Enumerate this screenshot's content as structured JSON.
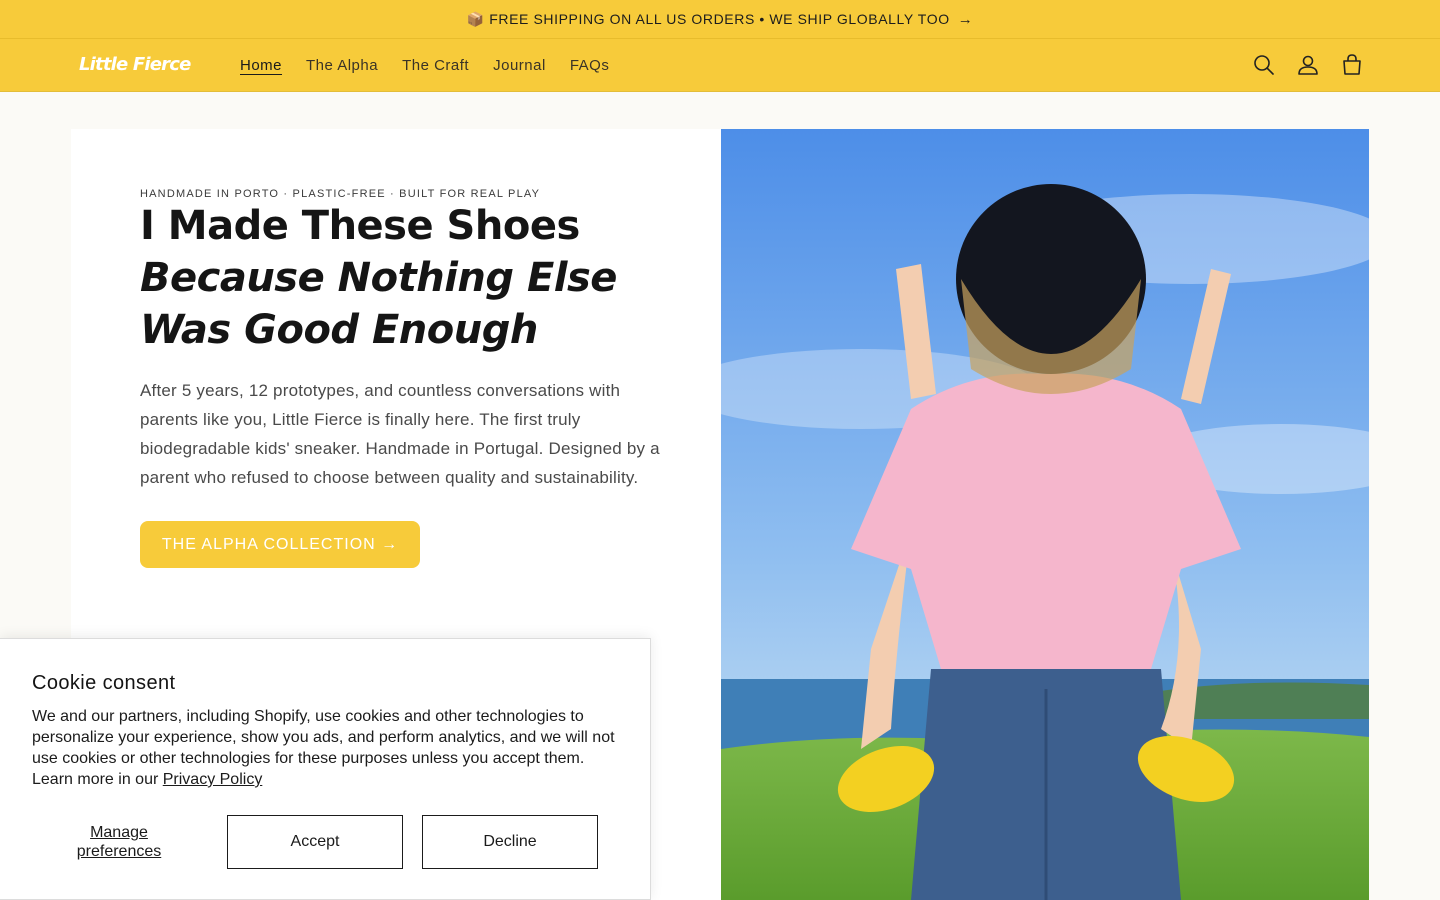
{
  "announcement": {
    "text": "📦 FREE SHIPPING ON ALL US ORDERS • WE SHIP GLOBALLY TOO",
    "arrow": "→"
  },
  "header": {
    "logo": "Little Fierce",
    "nav": [
      {
        "label": "Home",
        "active": true
      },
      {
        "label": "The Alpha"
      },
      {
        "label": "The Craft"
      },
      {
        "label": "Journal"
      },
      {
        "label": "FAQs"
      }
    ],
    "icons": [
      "search-icon",
      "account-icon",
      "cart-icon"
    ]
  },
  "hero": {
    "eyebrow": "HANDMADE IN PORTO · PLASTIC-FREE · BUILT FOR REAL PLAY",
    "headline_plain": "I Made These Shoes ",
    "headline_italic": "Because Nothing Else Was Good Enough",
    "body": "After 5 years, 12 prototypes, and countless conversations with parents like you, Little Fierce is finally here. The first truly biodegradable kids' sneaker. Handmade in Portugal. Designed by a parent who refused to choose between quality and sustainability.",
    "cta": "THE ALPHA COLLECTION →"
  },
  "cookie": {
    "title": "Cookie consent",
    "text": "We and our partners, including Shopify, use cookies and other technologies to personalize your experience, show you ads, and perform analytics, and we will not use cookies or other technologies for these purposes unless you accept them. Learn more in our ",
    "link": "Privacy Policy",
    "manage": "Manage preferences",
    "accept": "Accept",
    "decline": "Decline"
  },
  "colors": {
    "brand_yellow": "#f7cb3a",
    "card_bg": "#ffffff",
    "page_bg": "#fbfaf6"
  }
}
